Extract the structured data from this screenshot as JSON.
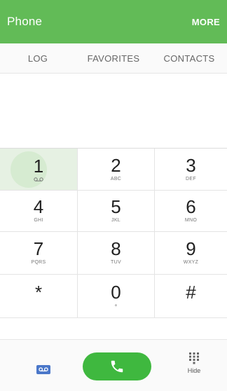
{
  "appbar": {
    "title": "Phone",
    "more_label": "MORE",
    "color": "#62bb57"
  },
  "tabs": [
    {
      "label": "LOG"
    },
    {
      "label": "FAVORITES"
    },
    {
      "label": "CONTACTS"
    }
  ],
  "keypad": {
    "pressed_key": "1",
    "keys": [
      {
        "digit": "1",
        "letters": "",
        "icon": "voicemail-icon"
      },
      {
        "digit": "2",
        "letters": "ABC"
      },
      {
        "digit": "3",
        "letters": "DEF"
      },
      {
        "digit": "4",
        "letters": "GHI"
      },
      {
        "digit": "5",
        "letters": "JKL"
      },
      {
        "digit": "6",
        "letters": "MNO"
      },
      {
        "digit": "7",
        "letters": "PQRS"
      },
      {
        "digit": "8",
        "letters": "TUV"
      },
      {
        "digit": "9",
        "letters": "WXYZ"
      },
      {
        "digit": "*",
        "letters": ""
      },
      {
        "digit": "0",
        "letters": "+"
      },
      {
        "digit": "#",
        "letters": ""
      }
    ]
  },
  "bottombar": {
    "voicemail_icon": "voicemail-icon",
    "call_icon": "phone-handset-icon",
    "call_color": "#3fb83f",
    "hide_icon": "keypad-grid-icon",
    "hide_label": "Hide"
  }
}
